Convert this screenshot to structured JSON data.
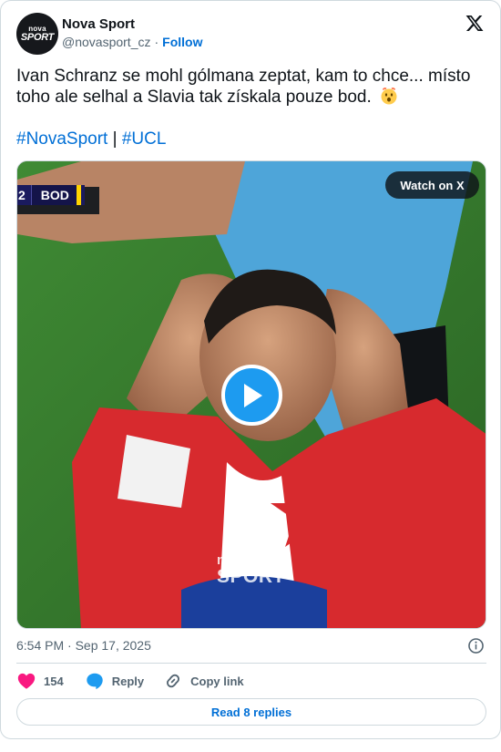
{
  "author": {
    "name": "Nova Sport",
    "handle": "@novasport_cz",
    "separator": "·",
    "follow_label": "Follow",
    "avatar_text_top": "nova",
    "avatar_text_bottom": "SPORT"
  },
  "tweet": {
    "text": "Ivan Schranz se mohl gólmana zeptat, kam to chce... místo toho ale selhal a Slavia tak získala pouze bod.",
    "emoji": "hushed-face-emoji",
    "hashtag_1": "#NovaSport",
    "hashtag_separator": " | ",
    "hashtag_2": "#UCL"
  },
  "media": {
    "watch_label": "Watch on X",
    "score_number": "2",
    "score_team": "BOD",
    "watermark_top": "nova",
    "watermark_bottom": "SPORT"
  },
  "meta": {
    "timestamp": "6:54 PM · Sep 17, 2025"
  },
  "actions": {
    "like_count": "154",
    "reply_label": "Reply",
    "copy_label": "Copy link"
  },
  "read_replies_label": "Read 8 replies",
  "colors": {
    "link": "#006fd6",
    "like": "#f91880",
    "reply_icon": "#1d9bf0",
    "muted": "#536471",
    "border": "#cfd9de"
  }
}
